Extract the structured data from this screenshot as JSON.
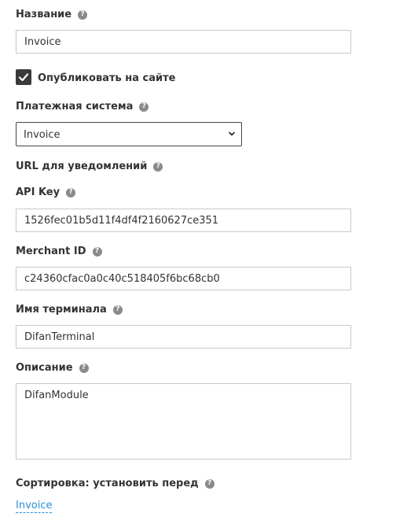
{
  "fields": {
    "name": {
      "label": "Название",
      "value": "Invoice"
    },
    "publish": {
      "label": "Опубликовать на сайте",
      "checked": true
    },
    "payment_system": {
      "label": "Платежная система",
      "selected": "Invoice"
    },
    "notify_url": {
      "label": "URL для уведомлений"
    },
    "api_key": {
      "label": "API Key",
      "value": "1526fec01b5d11f4df4f2160627ce351"
    },
    "merchant_id": {
      "label": "Merchant ID",
      "value": "c24360cfac0a0c40c518405f6bc68cb0"
    },
    "terminal_name": {
      "label": "Имя терминала",
      "value": "DifanTerminal"
    },
    "description": {
      "label": "Описание",
      "value": "DifanModule"
    },
    "sorting": {
      "label": "Сортировка: установить перед",
      "link_text": "Invoice"
    }
  },
  "icons": {
    "help": "question-circle-icon",
    "check": "check-icon",
    "dropdown": "chevron-down-icon"
  },
  "colors": {
    "link": "#2a8fd6",
    "help_icon": "#8a8a8a",
    "checkbox": "#3a3a3a"
  }
}
